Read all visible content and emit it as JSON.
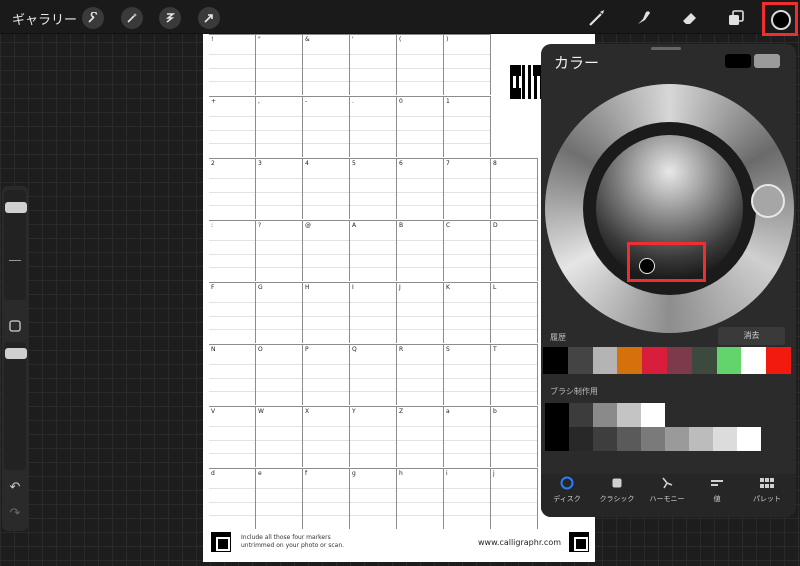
{
  "topbar": {
    "gallery_label": "ギャラリー",
    "left_tools": [
      "wrench-icon",
      "wand-icon",
      "selection-icon",
      "transform-icon"
    ],
    "right_tools": [
      "brush-icon",
      "smudge-icon",
      "eraser-icon",
      "layers-icon"
    ],
    "current_color": "#000000"
  },
  "sidebar": {
    "brush_size_level": 0.88,
    "opacity_level": 0.95
  },
  "page": {
    "rows": [
      [
        "!",
        "\"",
        "&",
        "'",
        "(",
        ")",
        ""
      ],
      [
        "+",
        ",",
        "-",
        ".",
        "0",
        "1",
        ""
      ],
      [
        "2",
        "3",
        "4",
        "5",
        "6",
        "7",
        "8"
      ],
      [
        ":",
        "?",
        "@",
        "A",
        "B",
        "C",
        "D"
      ],
      [
        "F",
        "G",
        "H",
        "I",
        "J",
        "K",
        "L"
      ],
      [
        "N",
        "O",
        "P",
        "Q",
        "R",
        "S",
        "T"
      ],
      [
        "V",
        "W",
        "X",
        "Y",
        "Z",
        "a",
        "b"
      ],
      [
        "d",
        "e",
        "f",
        "g",
        "h",
        "i",
        "j"
      ]
    ],
    "note_line1": "Include all those four markers",
    "note_line2": "untrimmed on your photo or scan.",
    "url": "www.calligraphr.com"
  },
  "color_panel": {
    "title": "カラー",
    "current_swatch": "#000000",
    "previous_swatch": "#9a9a9a",
    "history_label": "履歴",
    "clear_label": "消去",
    "history_colors": [
      "#000000",
      "#444444",
      "#b4b4b4",
      "#d4710a",
      "#d81e3c",
      "#7c3a4a",
      "#3b4a3d",
      "#62d46b",
      "#ffffff",
      "#f21a0e"
    ],
    "brush_label": "ブラシ制作用",
    "brush_row1": [
      "#000000",
      "#3c3c3c",
      "#8a8a8a",
      "#c4c4c4",
      "#ffffff"
    ],
    "brush_row2": [
      "#000000",
      "#282828",
      "#3e3e3e",
      "#5a5a5a",
      "#7a7a7a",
      "#9a9a9a",
      "#bcbcbc",
      "#dcdcdc",
      "#ffffff"
    ],
    "tabs": [
      {
        "label": "ディスク",
        "icon": "disc-icon",
        "active": true
      },
      {
        "label": "クラシック",
        "icon": "square-icon",
        "active": false
      },
      {
        "label": "ハーモニー",
        "icon": "harmony-icon",
        "active": false
      },
      {
        "label": "値",
        "icon": "sliders-icon",
        "active": false
      },
      {
        "label": "パレット",
        "icon": "palette-grid-icon",
        "active": false
      }
    ]
  }
}
